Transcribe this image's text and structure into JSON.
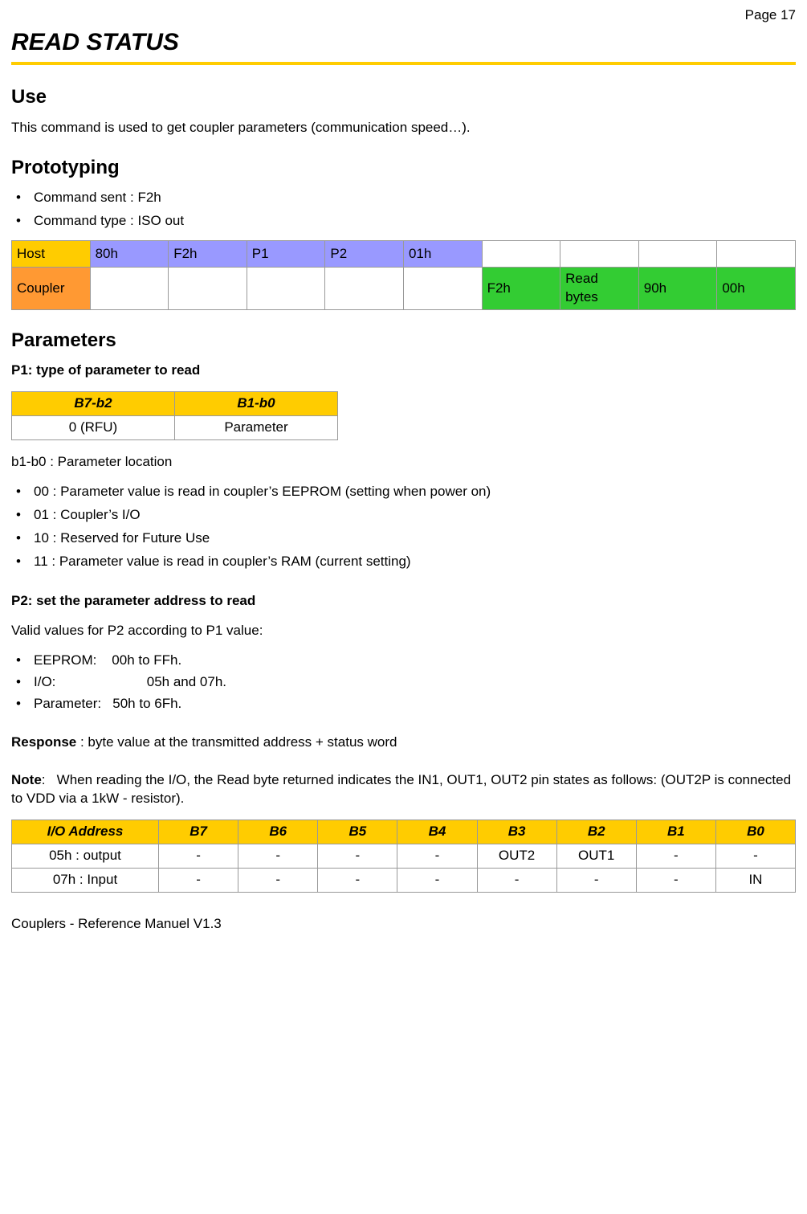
{
  "page_num": "Page 17",
  "title": "READ STATUS",
  "use": {
    "heading": "Use",
    "text": "This command is used to get coupler parameters (communication speed…)."
  },
  "prototyping": {
    "heading": "Prototyping",
    "items": [
      "Command sent : F2h",
      "Command type : ISO out"
    ],
    "proto_table": {
      "host_label": "Host",
      "host_cells": [
        "80h",
        "F2h",
        "P1",
        "P2",
        "01h"
      ],
      "coupler_label": "Coupler",
      "coupler_cells": [
        "F2h",
        "Read bytes",
        "90h",
        "00h"
      ]
    }
  },
  "parameters": {
    "heading": "Parameters",
    "p1_heading": "P1: type of parameter to read",
    "p1_table": {
      "headers": [
        "B7-b2",
        "B1-b0"
      ],
      "row": [
        "0 (RFU)",
        "Parameter"
      ]
    },
    "b1b0_label": "b1-b0 : Parameter location",
    "b1b0_items": [
      "00 : Parameter value is read in coupler’s EEPROM (setting when power on)",
      "01 : Coupler’s I/O",
      "10 : Reserved for Future Use",
      "11 : Parameter value is read in coupler’s RAM (current setting)"
    ],
    "p2_heading": "P2: set the parameter address to read",
    "p2_intro": "Valid values for P2 according to P1 value:",
    "p2_items": [
      "EEPROM:    00h to FFh.",
      "I/O:                        05h and 07h.",
      "Parameter:   50h to 6Fh."
    ],
    "response_label": "Response",
    "response_text": " : byte value at the transmitted address + status word",
    "note_label": "Note",
    "note_text": ":   When reading the I/O, the Read byte returned indicates the IN1, OUT1, OUT2 pin states as follows: (OUT2P is connected to VDD via a 1kW - resistor).",
    "io_table": {
      "headers": [
        "I/O  Address",
        "B7",
        "B6",
        "B5",
        "B4",
        "B3",
        "B2",
        "B1",
        "B0"
      ],
      "rows": [
        [
          "05h : output",
          "-",
          "-",
          "-",
          "-",
          "OUT2",
          "OUT1",
          "-",
          "-"
        ],
        [
          "07h : Input",
          "-",
          "-",
          "-",
          "-",
          "-",
          "-",
          "-",
          "IN"
        ]
      ]
    }
  },
  "footer": "Couplers - Reference Manuel V1.3"
}
